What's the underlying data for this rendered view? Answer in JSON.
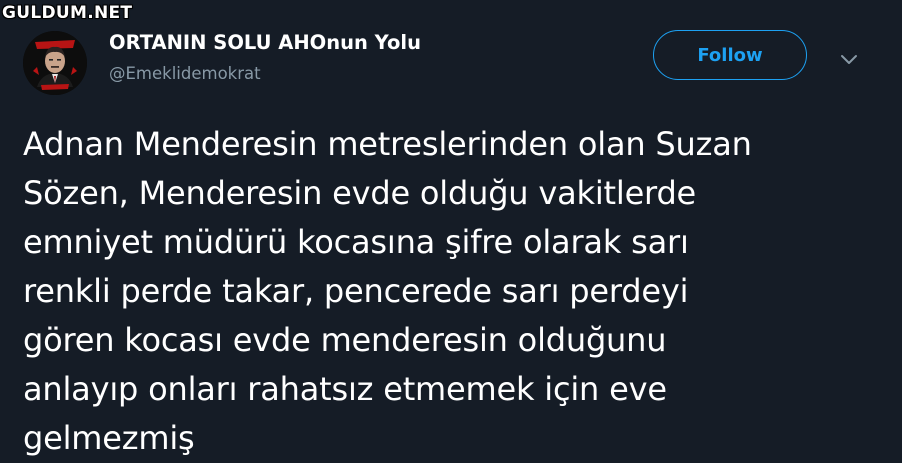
{
  "watermark": {
    "text": "GULDUM.NET"
  },
  "user": {
    "display_name": "ORTANIN SOLU AHOnun Yolu",
    "handle": "@Emeklidemokrat",
    "avatar_caption": "KELİM ALİ"
  },
  "follow": {
    "label": "Follow"
  },
  "colors": {
    "background": "#151c26",
    "accent": "#1da1f2",
    "secondary_text": "#8899a6"
  },
  "icons": {
    "menu": "chevron-down-icon"
  },
  "tweet": {
    "text": "Adnan Menderesin metreslerinden olan Suzan\nSözen, Menderesin evde olduğu vakitlerde\nemniyet müdürü kocasına  şifre olarak sarı\nrenkli perde takar, pencerede sarı perdeyi\ngören kocası evde menderesin olduğunu\nanlayıp onları rahatsız etmemek için eve\ngelmezmiş"
  }
}
